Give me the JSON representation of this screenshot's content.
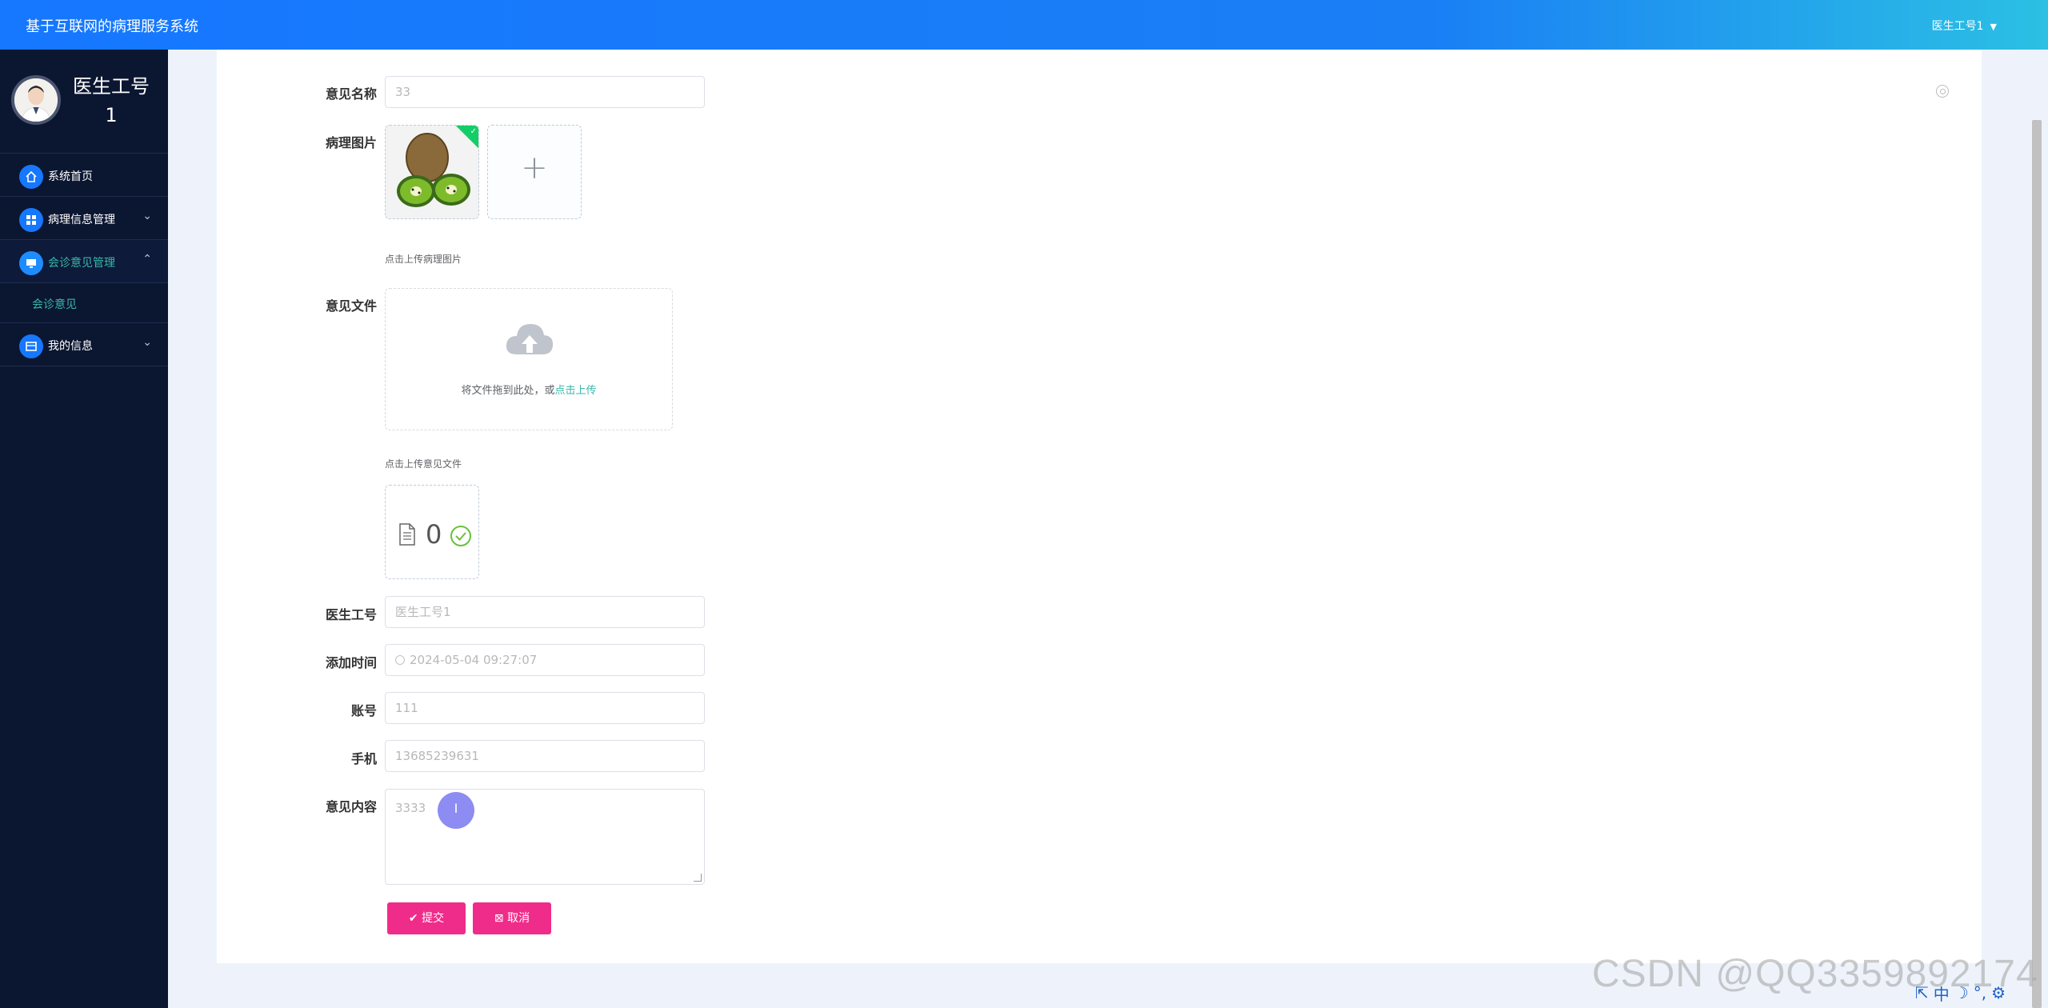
{
  "header": {
    "title": "基于互联网的病理服务系统",
    "user": "医生工号1"
  },
  "sidebar": {
    "profile_name": "医生工号1",
    "items": [
      {
        "label": "系统首页"
      },
      {
        "label": "病理信息管理"
      },
      {
        "label": "会诊意见管理"
      },
      {
        "label": "会诊意见"
      },
      {
        "label": "我的信息"
      }
    ]
  },
  "form": {
    "opinion_name": {
      "label": "意见名称",
      "value": "33"
    },
    "pathology_image": {
      "label": "病理图片",
      "hint": "点击上传病理图片"
    },
    "opinion_file": {
      "label": "意见文件",
      "drop_text": "将文件拖到此处，或",
      "drop_link": "点击上传",
      "hint": "点击上传意见文件",
      "file_name": "0"
    },
    "doctor_id": {
      "label": "医生工号",
      "value": "医生工号1"
    },
    "add_time": {
      "label": "添加时间",
      "value": "2024-05-04 09:27:07"
    },
    "account": {
      "label": "账号",
      "value": "111"
    },
    "phone": {
      "label": "手机",
      "value": "13685239631"
    },
    "content": {
      "label": "意见内容",
      "value": "3333"
    },
    "submit_label": "提交",
    "cancel_label": "取消"
  },
  "watermark": "CSDN @QQ3359892174",
  "ime": {
    "lang": "中"
  },
  "colors": {
    "primary": "#1677ff",
    "sidebar_bg": "#0b1631",
    "accent_text": "#37b8a8",
    "button": "#f02c8a"
  }
}
